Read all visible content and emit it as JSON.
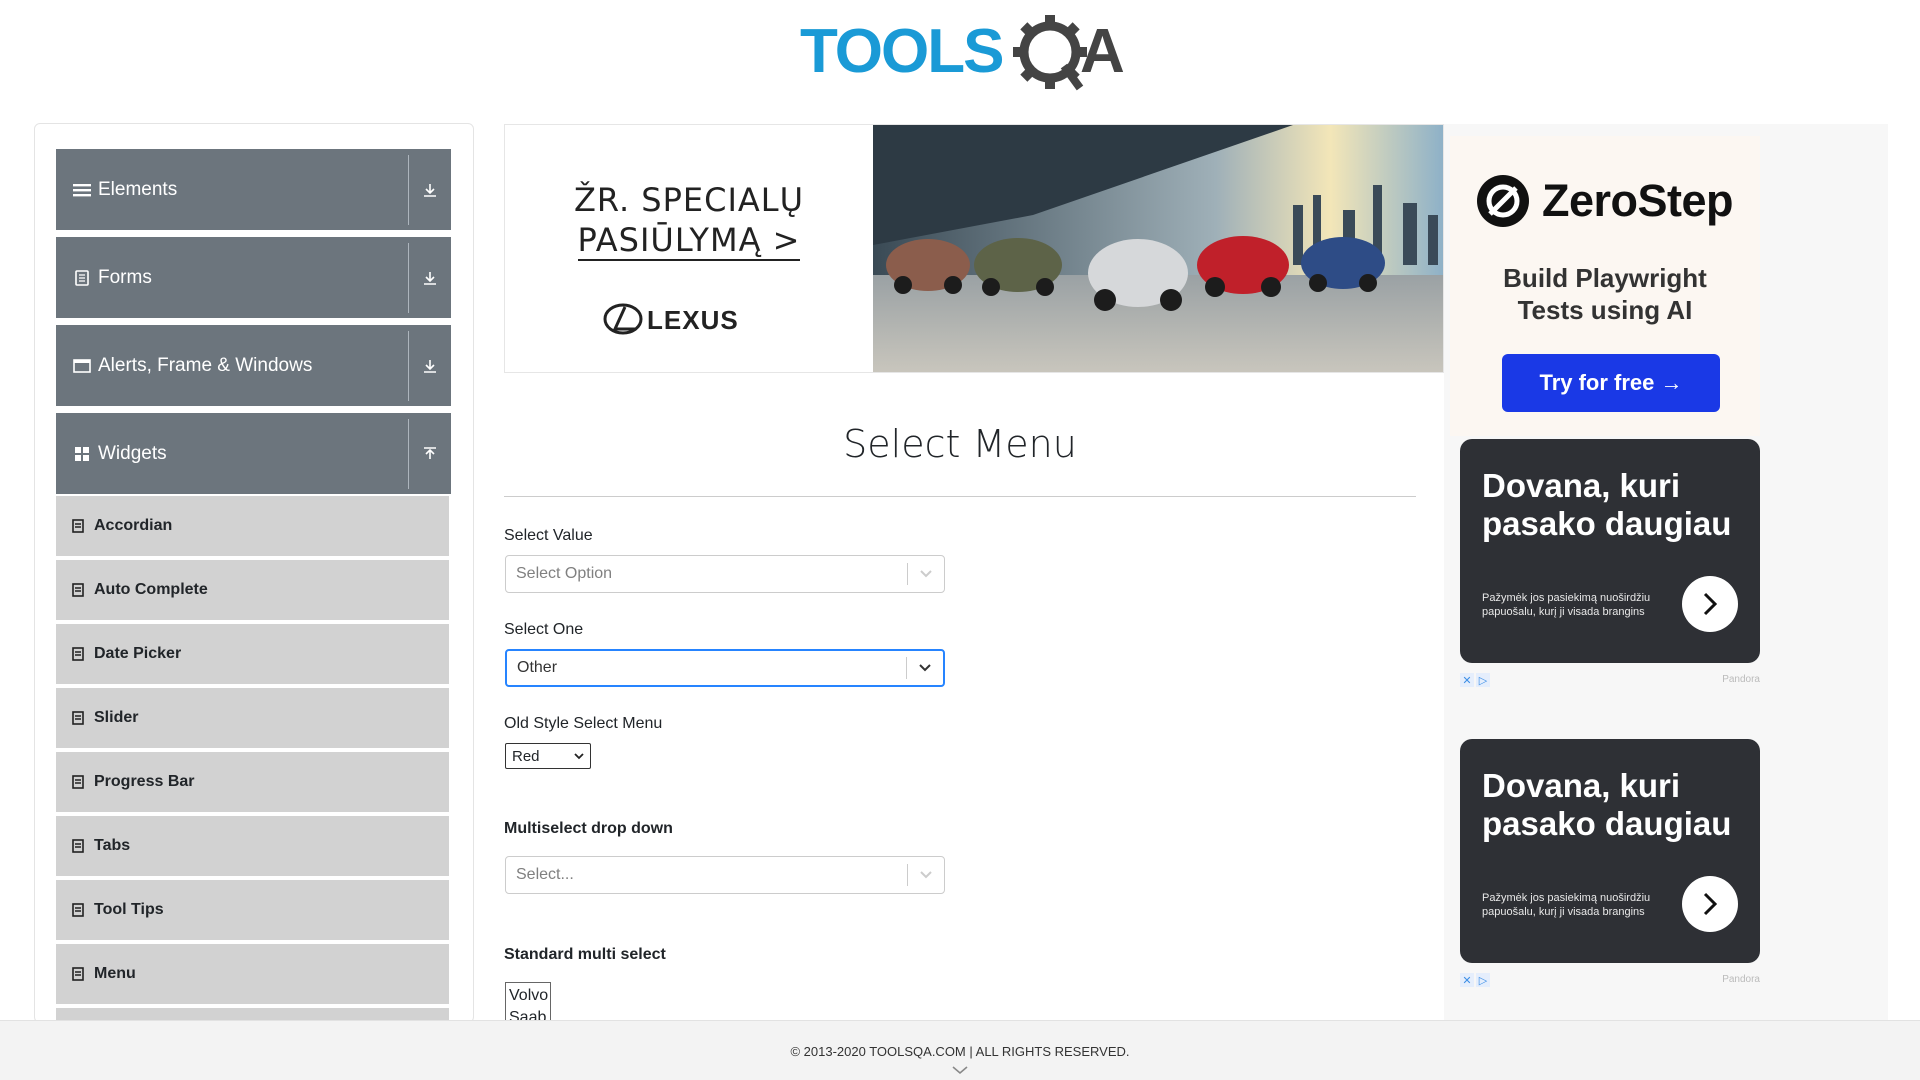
{
  "header": {
    "logo_text": "TOOLSQA",
    "logo_icon": "gear-magnifier-icon"
  },
  "sidebar": {
    "groups": [
      {
        "label": "Elements",
        "icon": "hamburger-icon",
        "state": "collapsed"
      },
      {
        "label": "Forms",
        "icon": "document-icon",
        "state": "collapsed"
      },
      {
        "label": "Alerts, Frame & Windows",
        "icon": "window-icon",
        "state": "collapsed"
      },
      {
        "label": "Widgets",
        "icon": "grid-icon",
        "state": "expanded"
      }
    ],
    "items": [
      "Accordian",
      "Auto Complete",
      "Date Picker",
      "Slider",
      "Progress Bar",
      "Tabs",
      "Tool Tips",
      "Menu"
    ]
  },
  "banner": {
    "cta_line1": "ŽR. SPECIALŲ",
    "cta_line2": "PASIŪLYMĄ >",
    "brand": "LEXUS"
  },
  "main": {
    "title": "Select Menu",
    "select_value": {
      "label": "Select Value",
      "placeholder": "Select Option"
    },
    "select_one": {
      "label": "Select One",
      "value": "Other"
    },
    "old_style": {
      "label": "Old Style Select Menu",
      "value": "Red"
    },
    "multiselect": {
      "label": "Multiselect drop down",
      "placeholder": "Select..."
    },
    "standard_multi": {
      "label": "Standard multi select",
      "options": [
        "Volvo",
        "Saab"
      ]
    }
  },
  "ads": {
    "zerostep": {
      "name": "ZeroStep",
      "line1": "Build Playwright",
      "line2": "Tests using AI",
      "button": "Try for free →"
    },
    "dovana": [
      {
        "line1": "Dovana, kuri",
        "line2": "pasako daugiau",
        "sub": "Pažymėk jos pasiekimą nuoširdžiu papuošalu, kurį ji visada brangins",
        "brand": "Pandora"
      },
      {
        "line1": "Dovana, kuri",
        "line2": "pasako daugiau",
        "sub": "Pažymėk jos pasiekimą nuoširdžiu papuošalu, kurį ji visada brangins",
        "brand": "Pandora"
      }
    ]
  },
  "footer": {
    "text": "© 2013-2020 TOOLSQA.COM | ALL RIGHTS RESERVED."
  },
  "colors": {
    "group_bg": "#6c757d",
    "item_bg": "#d2d2d2",
    "logo_blue": "#1a9ad6",
    "logo_dark": "#444",
    "focus": "#2684ff",
    "ad_button": "#1a39e6"
  }
}
